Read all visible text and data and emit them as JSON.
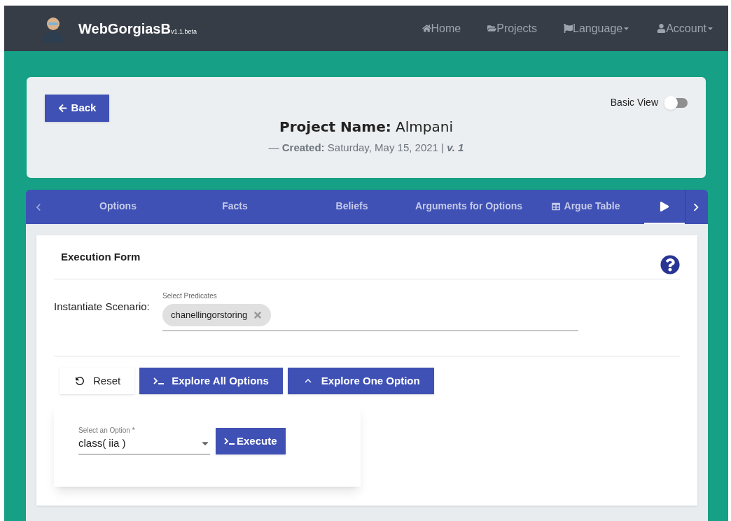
{
  "navbar": {
    "brand": "WebGorgiasB",
    "version": "v1.1.beta",
    "links": [
      {
        "label": "Home",
        "kind": "home",
        "dropdown": false
      },
      {
        "label": "Projects",
        "kind": "folder",
        "dropdown": false
      },
      {
        "label": "Language",
        "kind": "flag",
        "dropdown": true
      },
      {
        "label": "Account",
        "kind": "user",
        "dropdown": true
      }
    ]
  },
  "project": {
    "back": "Back",
    "basic_view": {
      "label": "Basic View",
      "on": false
    },
    "name_label": "Project Name:",
    "name": "Almpani",
    "dash": "—",
    "created_label": "Created:",
    "created": "Saturday, May 15, 2021 |",
    "version": "v. 1"
  },
  "tabs": [
    {
      "label": "Options",
      "kind": "plain",
      "selected": false
    },
    {
      "label": "Facts",
      "kind": "plain",
      "selected": false
    },
    {
      "label": "Beliefs",
      "kind": "plain",
      "selected": false
    },
    {
      "label": "Arguments for Options",
      "kind": "plain",
      "selected": false
    },
    {
      "label": "Argue Table",
      "kind": "table",
      "selected": false
    },
    {
      "kind": "play",
      "selected": true
    }
  ],
  "form": {
    "title": "Execution Form",
    "scenario_label": "Instantiate Scenario:",
    "predicates_label": "Select Predicates",
    "chips": [
      "chanellingorstoring"
    ],
    "buttons": [
      {
        "label": "Reset",
        "kind": "reset"
      },
      {
        "label": "Explore All Options",
        "kind": "terminal"
      },
      {
        "label": "Explore One Option",
        "kind": "collapse"
      }
    ],
    "option": {
      "label": "Select an Option *",
      "value": "class( iia )",
      "execute": "Execute"
    }
  }
}
